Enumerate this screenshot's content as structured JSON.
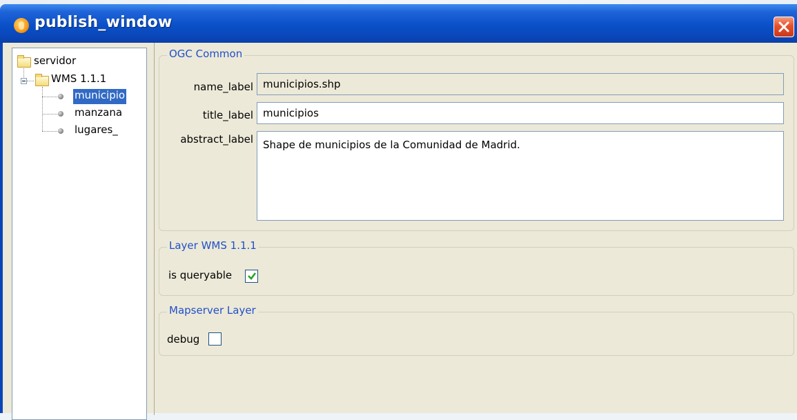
{
  "window": {
    "title": "publish_window"
  },
  "tree": {
    "root_label": "servidor",
    "wms_label": "WMS 1.1.1",
    "layers": [
      {
        "label": "municipio",
        "selected": true
      },
      {
        "label": "manzana",
        "selected": false
      },
      {
        "label": "lugares_",
        "selected": false
      }
    ]
  },
  "ogc_common": {
    "legend": "OGC Common",
    "name_label": "name_label",
    "name_value": "municipios.shp",
    "title_label": "title_label",
    "title_value": "municipios",
    "abstract_label": "abstract_label",
    "abstract_value": "Shape de municipios de la Comunidad de Madrid."
  },
  "layer_wms": {
    "legend": "Layer WMS 1.1.1",
    "queryable_label": "is queryable",
    "queryable_checked": true
  },
  "mapserver_layer": {
    "legend": "Mapserver Layer",
    "debug_label": "debug",
    "debug_checked": false
  },
  "colors": {
    "titlebar": "#0a50c8",
    "legend_text": "#2150c8",
    "selection": "#316ac5",
    "panel": "#ece9d8",
    "close_button": "#e5522c",
    "check_green": "#21a121"
  }
}
